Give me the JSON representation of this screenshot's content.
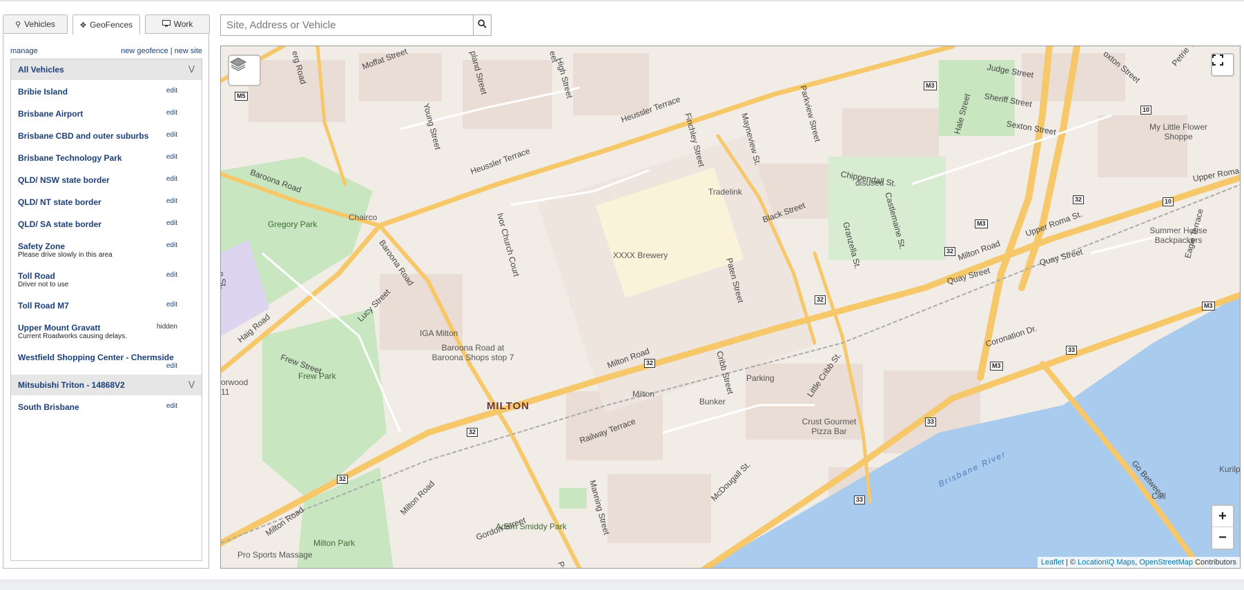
{
  "tabs": [
    {
      "label": "Vehicles",
      "icon": "map-marker-icon"
    },
    {
      "label": "GeoFences",
      "icon": "move-icon"
    },
    {
      "label": "Work",
      "icon": "monitor-icon"
    }
  ],
  "active_tab": "GeoFences",
  "toolbar": {
    "manage": "manage",
    "new_geofence": "new geofence",
    "separator": "|",
    "new_site": "new site"
  },
  "groups": [
    {
      "name": "All Vehicles",
      "items": [
        {
          "name": "Bribie Island",
          "action": "edit"
        },
        {
          "name": "Brisbane Airport",
          "action": "edit"
        },
        {
          "name": "Brisbane CBD and outer suburbs",
          "action": "edit"
        },
        {
          "name": "Brisbane Technology Park",
          "action": "edit"
        },
        {
          "name": "QLD/ NSW state border",
          "action": "edit"
        },
        {
          "name": "QLD/ NT state border",
          "action": "edit"
        },
        {
          "name": "QLD/ SA state border",
          "action": "edit"
        },
        {
          "name": "Safety Zone",
          "desc": "Please drive slowly in this area",
          "action": "edit"
        },
        {
          "name": "Toll Road",
          "desc": "Driver not to use",
          "action": "edit"
        },
        {
          "name": "Toll Road M7",
          "action": "edit"
        },
        {
          "name": "Upper Mount Gravatt",
          "desc": "Current Roadworks causing delays.",
          "action": "hidden"
        },
        {
          "name": "Westfield Shopping Center - Chermside",
          "action": "edit"
        }
      ]
    },
    {
      "name": "Mitsubishi Triton - 14868V2",
      "items": [
        {
          "name": "South Brisbane",
          "action": "edit"
        }
      ]
    }
  ],
  "search": {
    "placeholder": "Site, Address or Vehicle",
    "value": ""
  },
  "map": {
    "suburb": "MILTON",
    "places": [
      "Gregory Park",
      "Frew Park",
      "Milton Park",
      "Adam Smiddy Park",
      "XXXX Brewery",
      "Tradelink",
      "Chairco",
      "IGA Milton",
      "Baroona Road at Baroona Shops stop 7",
      "Milton",
      "Bunker",
      "Parking",
      "Crust Gourmet Pizza Bar",
      "disused",
      "My Little Flower Shoppe",
      "Summer House Backpackers",
      "Pro Sports Massage",
      "orwood",
      "11",
      "Cell",
      "Kurilp"
    ],
    "roads": [
      "Moffat Street",
      "Heussler Terrace",
      "Heussler Terrace",
      "Baroona Road",
      "Baroona Road",
      "Milton Road",
      "Milton Road",
      "Milton Road",
      "Haig Road",
      "Frew Street",
      "Lucy Street",
      "Railway Terrace",
      "Gordon Street",
      "Milton Road",
      "Manning Street",
      "McDougall St.",
      "Cribb Street",
      "Little Cribb St.",
      "Coronation Dr.",
      "Quay Street",
      "Quay Street",
      "Upper Roma St.",
      "Black Street",
      "Granzella St.",
      "Paten Street",
      "Castlemaine St.",
      "Chippendall St.",
      "Finchley Street",
      "Mayneview St.",
      "Parkview Street",
      "Young Street",
      "High Street",
      "Judge Street",
      "Sheriff Street",
      "Sexton Street",
      "Hale Street",
      "Ivor Church Court",
      "Brisbane River",
      "Go Between",
      "Petrie Terrace",
      "Eagle Terrace",
      "Upper Roma",
      "oxton Street",
      "erg Road",
      "pland Street",
      "eet",
      "Paten",
      "n St."
    ],
    "shields": [
      "M5",
      "M3",
      "M3",
      "M3",
      "M3",
      "10",
      "10",
      "32",
      "32",
      "32",
      "32",
      "32",
      "32",
      "33",
      "33",
      "33"
    ],
    "attribution": {
      "leaflet": "Leaflet",
      "sep": "| ©",
      "locationiq": "LocationIQ Maps",
      "comma": ",",
      "osm": "OpenStreetMap",
      "suffix": "Contributors"
    },
    "zoom_in": "+",
    "zoom_out": "−",
    "colors": {
      "land": "#f1ece6",
      "park": "#c8e6c0",
      "water": "#a9cbee",
      "primary_road": "#f7c86a",
      "motorway": "#f0a64a",
      "building": "#e6d7d0"
    }
  }
}
